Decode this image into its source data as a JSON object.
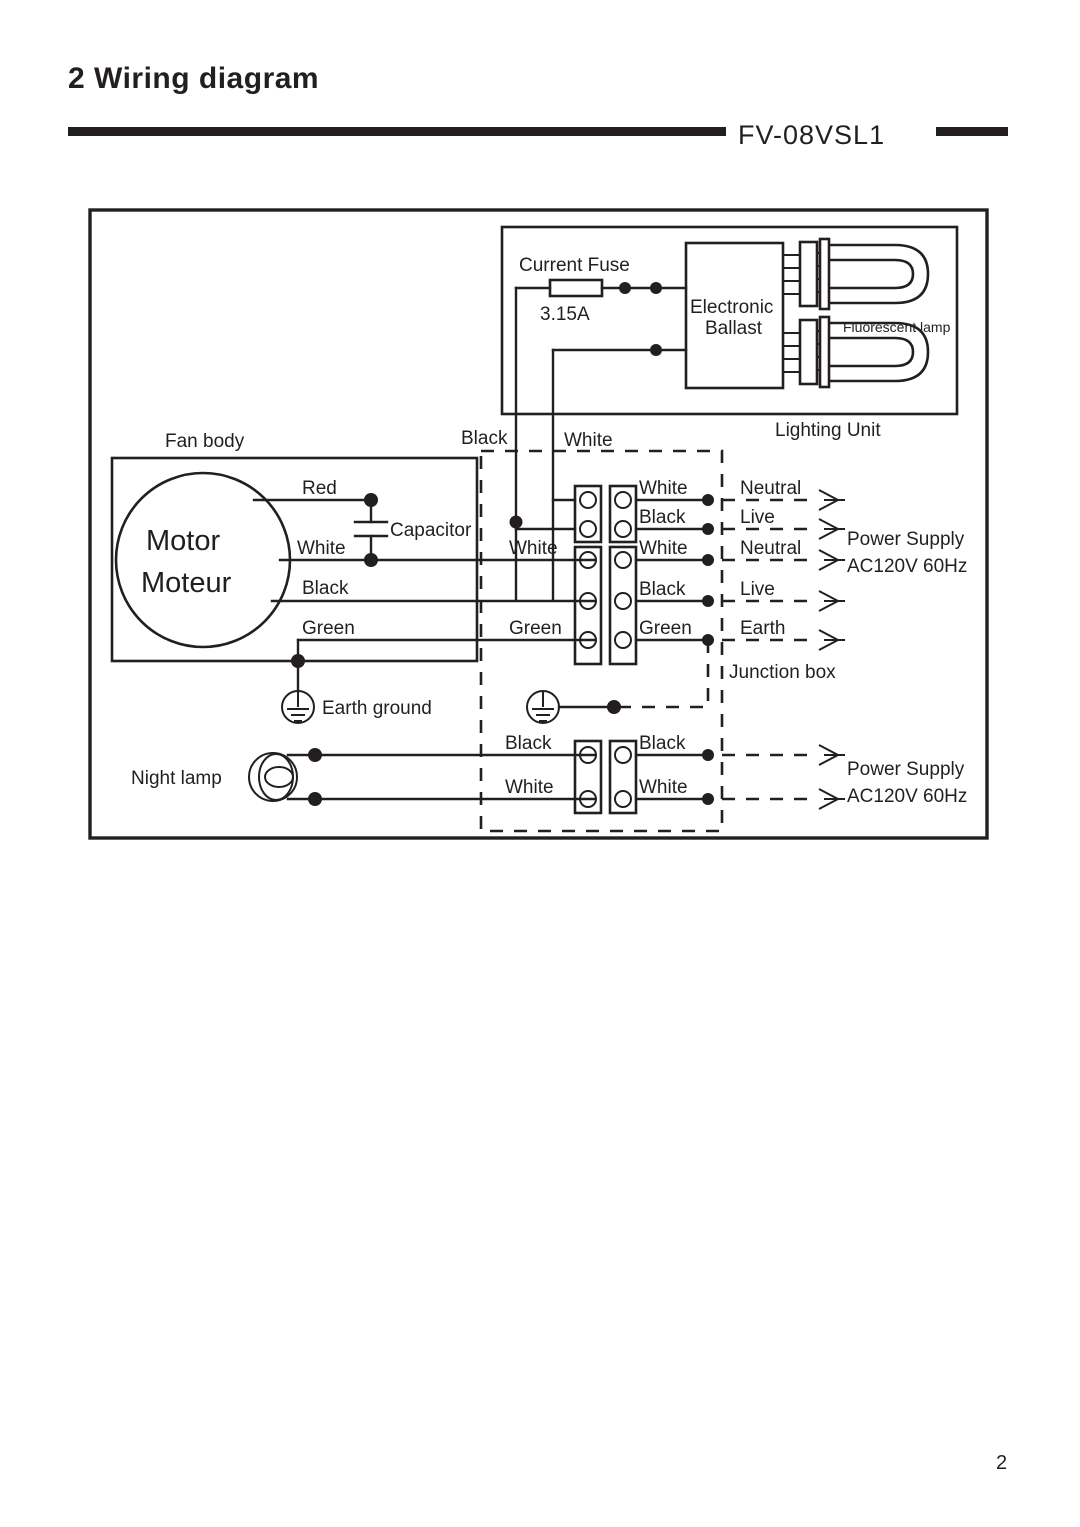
{
  "header": {
    "section_number": "2",
    "title": "2 Wiring diagram",
    "model": "FV-08VSL1"
  },
  "footer": {
    "page_number": "2"
  },
  "diagram": {
    "lighting_unit": {
      "label": "Lighting Unit",
      "fuse_label": "Current Fuse",
      "fuse_rating": "3.15A",
      "ballast_line1": "Electronic",
      "ballast_line2": "Ballast",
      "lamp_label": "Fluorescent lamp"
    },
    "fan_body": {
      "label": "Fan body",
      "motor_line1": "Motor",
      "motor_line2": "Moteur",
      "capacitor_label": "Capacitor",
      "earth_ground_label": "Earth ground",
      "motor_wires": [
        {
          "color": "Red"
        },
        {
          "color": "White"
        },
        {
          "color": "Black"
        },
        {
          "color": "Green"
        }
      ]
    },
    "night_lamp": {
      "label": "Night lamp",
      "wires": [
        {
          "color": "Black"
        },
        {
          "color": "White"
        }
      ]
    },
    "junction_box": {
      "label": "Junction box",
      "lighting_feed": [
        {
          "color": "Black"
        },
        {
          "color": "White"
        }
      ],
      "terminal_group_lighting": {
        "left_wires": [],
        "right_wires": [
          {
            "color": "White",
            "function": "Neutral"
          },
          {
            "color": "Black",
            "function": "Live"
          }
        ]
      },
      "terminal_group_fan": {
        "left_wires": [
          {
            "color": "White"
          },
          {
            "color": ""
          },
          {
            "color": "Green"
          }
        ],
        "right_wires": [
          {
            "color": "White",
            "function": "Neutral"
          },
          {
            "color": "Black",
            "function": "Live"
          },
          {
            "color": "Green",
            "function": "Earth"
          }
        ]
      },
      "terminal_group_night_lamp": {
        "left_wires": [
          {
            "color": "Black"
          },
          {
            "color": "White"
          }
        ],
        "right_wires": [
          {
            "color": "Black"
          },
          {
            "color": "White"
          }
        ]
      }
    },
    "power_supply": {
      "label_line1": "Power Supply",
      "label_line2": "AC120V 60Hz",
      "label2_line1": "Power Supply",
      "label2_line2": "AC120V 60Hz"
    }
  },
  "colors": {
    "ink": "#231f20",
    "paper": "#ffffff"
  }
}
